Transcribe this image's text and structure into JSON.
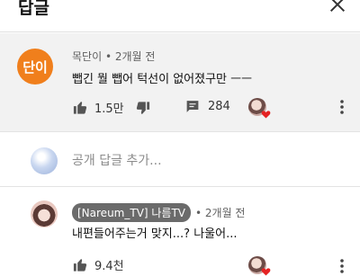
{
  "header": {
    "title": "답글"
  },
  "top_comment": {
    "avatar_text": "단이",
    "author": "목단이",
    "time": "2개월 전",
    "text": "뺍긴 뭘 뺍어 턱선이 없어졌구만 ㅡㅡ",
    "likes": "1.5만",
    "replies": "284"
  },
  "reply_box": {
    "placeholder": "공개 답글 추가..."
  },
  "reply_comment": {
    "author": "[Nareum_TV] 나름TV",
    "time": "2개월 전",
    "text": "내편들어주는거 맞지...? 나울어...",
    "likes": "9.4천"
  },
  "colors": {
    "avatar_orange": "#f07f1c",
    "heart_red": "#e52222",
    "highlight_bg": "#f2f2f2"
  }
}
